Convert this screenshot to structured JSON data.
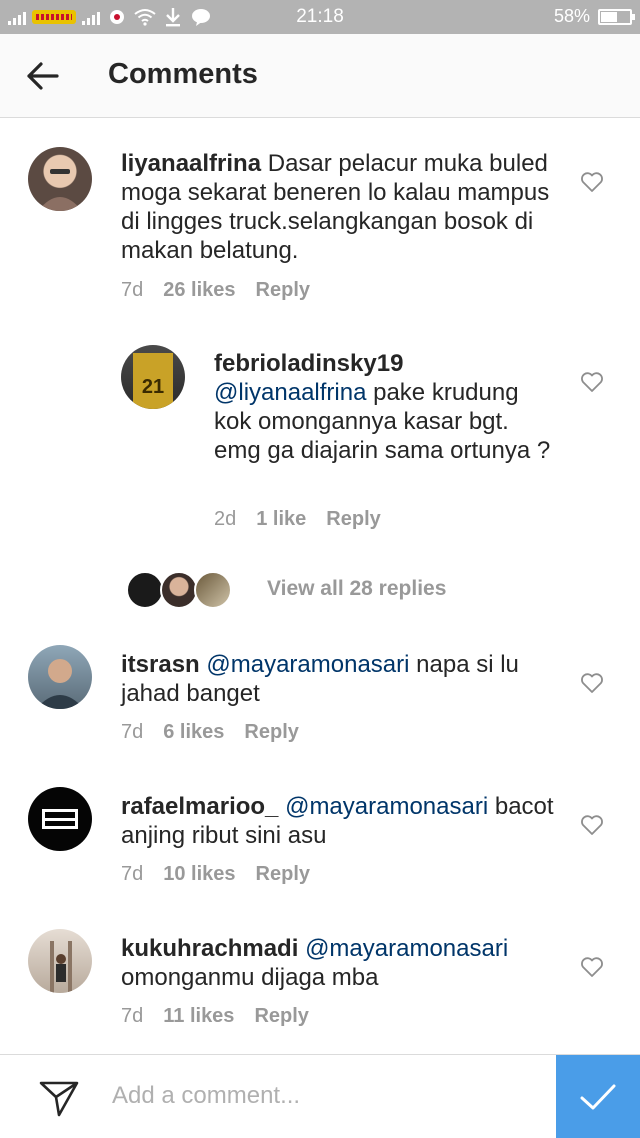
{
  "status_bar": {
    "time": "21:18",
    "battery": "58%",
    "battery_level": 0.58
  },
  "header": {
    "title": "Comments",
    "back_icon": "back-arrow-icon"
  },
  "comments": [
    {
      "username": "liyanaalfrina",
      "mention": "",
      "text": "Dasar pelacur muka buled moga sekarat beneren lo kalau mampus di lingges truck.selangkangan bosok di makan belatung.",
      "age": "7d",
      "likes": "26 likes",
      "reply": "Reply"
    },
    {
      "username": "febrioladinsky19",
      "mention": "@liyanaalfrina",
      "text": "pake krudung kok omongannya kasar bgt. emg ga diajarin sama ortunya ?",
      "age": "2d",
      "likes": "1 like",
      "reply": "Reply"
    },
    {
      "username": "itsrasn",
      "mention": "@mayaramonasari",
      "text": "napa si lu jahad banget",
      "age": "7d",
      "likes": "6 likes",
      "reply": "Reply"
    },
    {
      "username": "rafaelmarioo_",
      "mention": "@mayaramonasari",
      "text": "bacot anjing ribut sini asu",
      "age": "7d",
      "likes": "10 likes",
      "reply": "Reply"
    },
    {
      "username": "kukuhrachmadi",
      "mention": "@mayaramonasari",
      "text": "omonganmu dijaga mba",
      "age": "7d",
      "likes": "11 likes",
      "reply": "Reply"
    }
  ],
  "view_replies": {
    "label": "View all 28 replies"
  },
  "composer": {
    "placeholder": "Add a comment...",
    "send_icon": "paper-plane-icon",
    "post_icon": "checkmark-icon"
  },
  "colors": {
    "mention": "#003569",
    "meta": "#999999",
    "post_button": "#4a9de8",
    "status_bar": "#b3b3b3"
  }
}
